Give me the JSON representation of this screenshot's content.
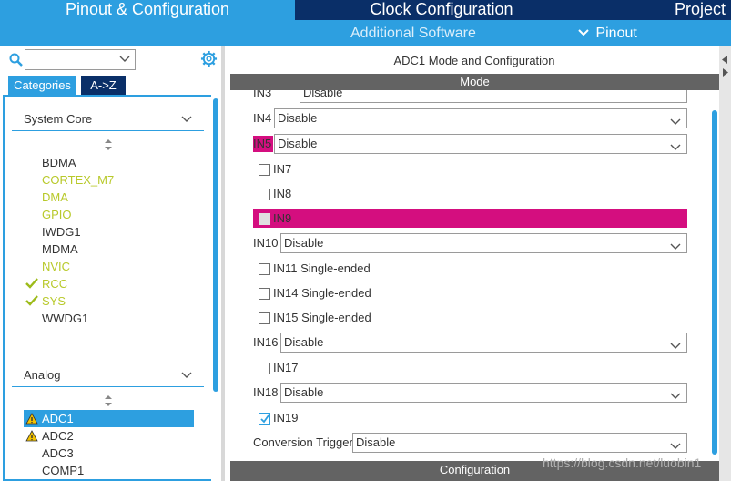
{
  "top_tabs": {
    "pinout": "Pinout & Configuration",
    "clock": "Clock Configuration",
    "project": "Project"
  },
  "sub_menu": {
    "additional_software": "Additional Software",
    "pinout": "Pinout"
  },
  "left": {
    "tab_categories": "Categories",
    "tab_az": "A->Z",
    "groups": {
      "system_core": {
        "label": "System Core",
        "items": [
          "BDMA",
          "CORTEX_M7",
          "DMA",
          "GPIO",
          "IWDG1",
          "MDMA",
          "NVIC",
          "RCC",
          "SYS",
          "WWDG1"
        ]
      },
      "analog": {
        "label": "Analog",
        "items": [
          "ADC1",
          "ADC2",
          "ADC3",
          "COMP1"
        ]
      }
    }
  },
  "right": {
    "title": "ADC1 Mode and Configuration",
    "mode_bar": "Mode",
    "config_bar": "Configuration",
    "rows": {
      "in3_label": "IN3",
      "in3_value": "Disable",
      "in4_label": "IN4",
      "in4_value": "Disable",
      "in5_label": "IN5",
      "in5_value": "Disable",
      "in7_label": "IN7",
      "in8_label": "IN8",
      "in9_label": "IN9",
      "in10_label": "IN10",
      "in10_value": "Disable",
      "in11_label": "IN11 Single-ended",
      "in14_label": "IN14 Single-ended",
      "in15_label": "IN15 Single-ended",
      "in16_label": "IN16",
      "in16_value": "Disable",
      "in17_label": "IN17",
      "in18_label": "IN18",
      "in18_value": "Disable",
      "in19_label": "IN19",
      "conv_trigger_label": "Conversion Trigger",
      "conv_trigger_value": "Disable"
    }
  },
  "watermark": "https://blog.csdn.net/luobin1",
  "colors": {
    "nav_dark": "#0a2f68",
    "nav_blue": "#2d9fe0",
    "highlight_magenta": "#d40e7f",
    "enabled_green": "#b8c92a",
    "check_green": "#9dbb1a",
    "warning_yellow": "#f2c200",
    "bar_gray": "#636363"
  }
}
